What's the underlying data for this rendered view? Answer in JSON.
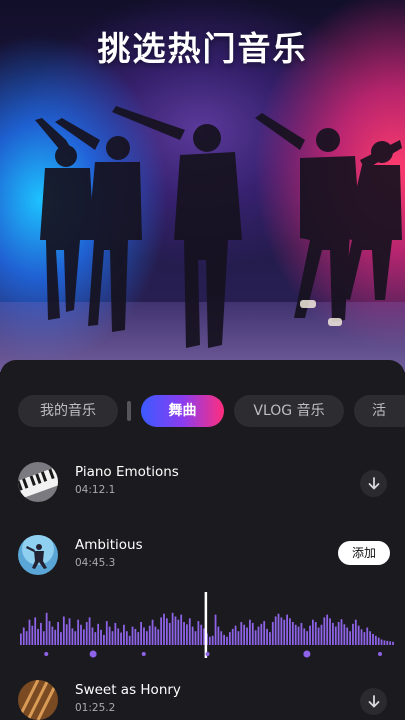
{
  "hero": {
    "title": "挑选热门音乐"
  },
  "tabs": [
    {
      "label": "我的音乐",
      "active": false
    },
    {
      "label": "舞曲",
      "active": true
    },
    {
      "label": "VLOG 音乐",
      "active": false
    },
    {
      "label": "活",
      "active": false
    }
  ],
  "tracks": [
    {
      "title": "Piano Emotions",
      "duration": "04:12.1",
      "action": "download-icon"
    },
    {
      "title": "Ambitious",
      "duration": "04:45.3",
      "action": "add",
      "add_label": "添加"
    },
    {
      "title": "Sweet as Honry",
      "duration": "01:25.2",
      "action": "download-icon"
    }
  ],
  "colors": {
    "accent_start": "#3b5bff",
    "accent_end": "#ff2e7d",
    "waveform": "#8e63e8",
    "sheet_bg": "#1b1b1f"
  },
  "waveform": {
    "levels": [
      0.25,
      0.38,
      0.3,
      0.55,
      0.42,
      0.6,
      0.35,
      0.48,
      0.3,
      0.7,
      0.52,
      0.4,
      0.33,
      0.5,
      0.28,
      0.62,
      0.45,
      0.58,
      0.36,
      0.3,
      0.55,
      0.44,
      0.34,
      0.5,
      0.6,
      0.38,
      0.28,
      0.46,
      0.33,
      0.22,
      0.52,
      0.4,
      0.3,
      0.48,
      0.36,
      0.27,
      0.44,
      0.3,
      0.2,
      0.4,
      0.35,
      0.28,
      0.5,
      0.38,
      0.3,
      0.42,
      0.55,
      0.4,
      0.34,
      0.6,
      0.68,
      0.58,
      0.48,
      0.7,
      0.62,
      0.55,
      0.66,
      0.5,
      0.45,
      0.58,
      0.4,
      0.3,
      0.52,
      0.44,
      0.36,
      0.25,
      0.18,
      0.2,
      0.66,
      0.4,
      0.3,
      0.22,
      0.18,
      0.28,
      0.35,
      0.42,
      0.3,
      0.5,
      0.44,
      0.38,
      0.55,
      0.48,
      0.32,
      0.4,
      0.46,
      0.52,
      0.35,
      0.28,
      0.5,
      0.62,
      0.68,
      0.6,
      0.55,
      0.66,
      0.58,
      0.5,
      0.44,
      0.4,
      0.48,
      0.36,
      0.3,
      0.42,
      0.55,
      0.5,
      0.38,
      0.44,
      0.6,
      0.66,
      0.58,
      0.48,
      0.4,
      0.5,
      0.56,
      0.45,
      0.38,
      0.3,
      0.46,
      0.55,
      0.42,
      0.34,
      0.28,
      0.38,
      0.3,
      0.24,
      0.2,
      0.16,
      0.12,
      0.1,
      0.09,
      0.08,
      0.07
    ],
    "playhead_fraction": 0.495,
    "markers": [
      0.07,
      0.195,
      0.33,
      0.5,
      0.765,
      0.96
    ],
    "big_markers": [
      0.195,
      0.765
    ]
  }
}
